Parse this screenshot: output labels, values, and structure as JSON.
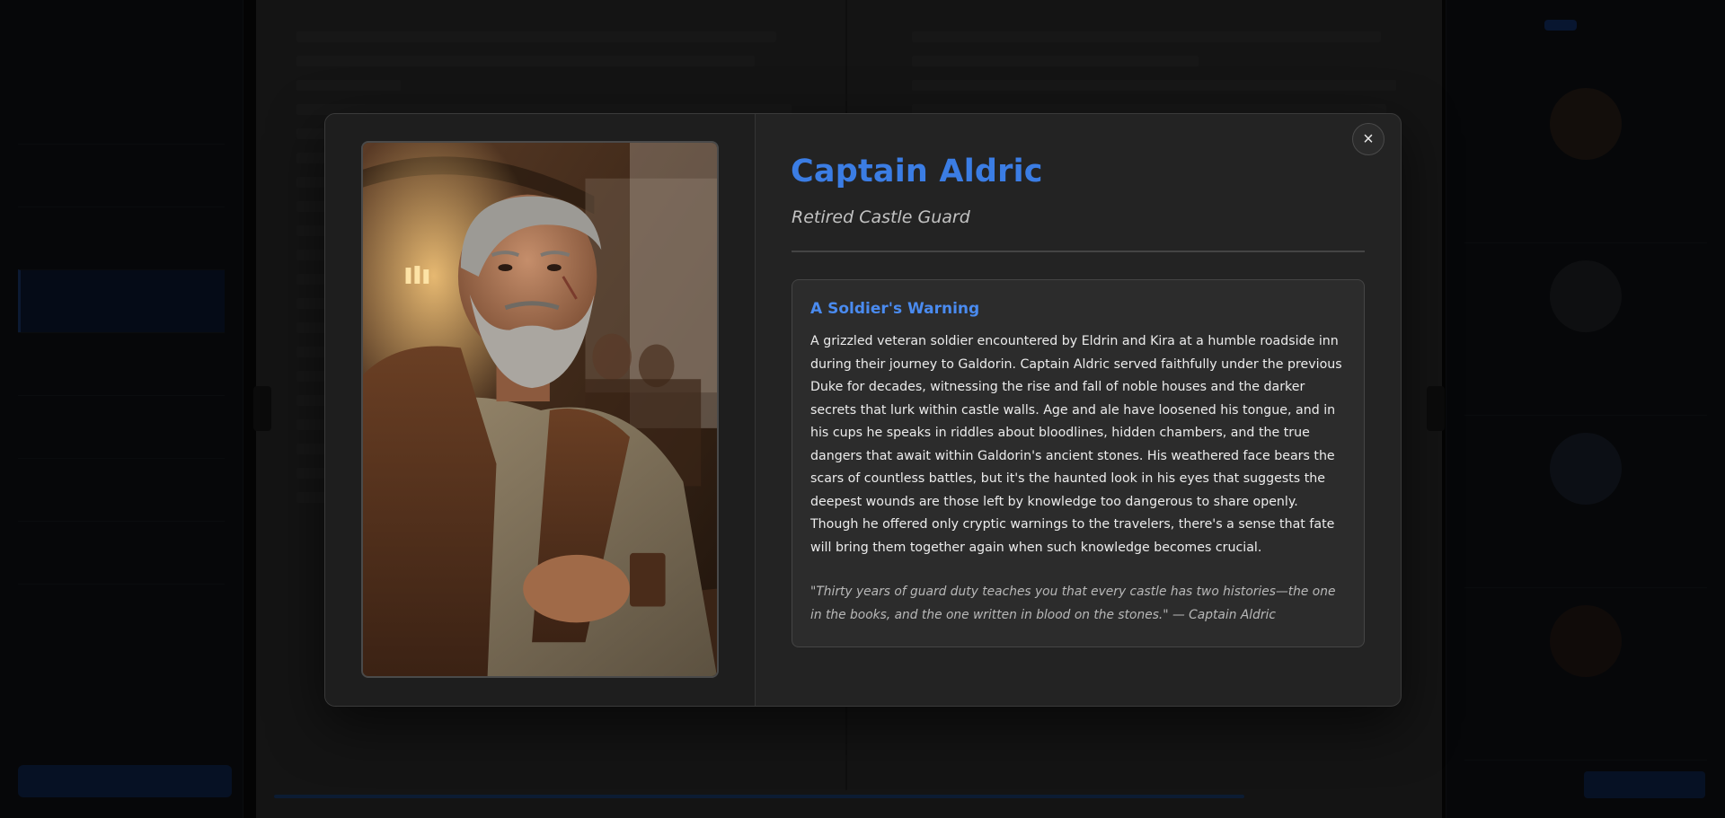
{
  "modal": {
    "close_label": "×",
    "character": {
      "name": "Captain Aldric",
      "role": "Retired Castle Guard",
      "portrait_icon": "character-portrait"
    },
    "bio": {
      "heading": "A Soldier's Warning",
      "text": "A grizzled veteran soldier encountered by Eldrin and Kira at a humble roadside inn during their journey to Galdorin. Captain Aldric served faithfully under the previous Duke for decades, witnessing the rise and fall of noble houses and the darker secrets that lurk within castle walls. Age and ale have loosened his tongue, and in his cups he speaks in riddles about bloodlines, hidden chambers, and the true dangers that await within Galdorin's ancient stones. His weathered face bears the scars of countless battles, but it's the haunted look in his eyes that suggests the deepest wounds are those left by knowledge too dangerous to share openly. Though he offered only cryptic warnings to the travelers, there's a sense that fate will bring them together again when such knowledge becomes crucial.",
      "quote": "\"Thirty years of guard duty teaches you that every castle has two histories—the one in the books, and the one written in blood on the stones.\" — Captain Aldric"
    },
    "accent_color": "#3b7de4"
  }
}
